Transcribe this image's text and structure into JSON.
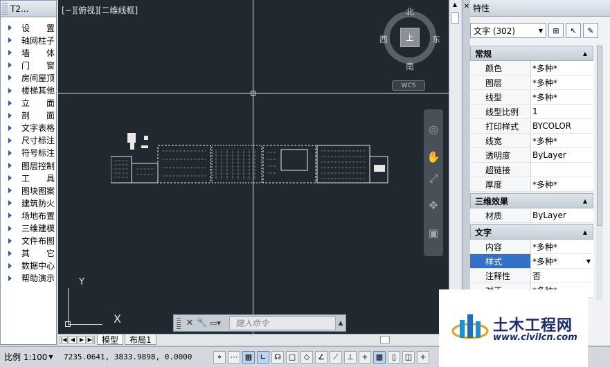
{
  "left_panel": {
    "title": "T2...",
    "items": [
      {
        "label": "设置",
        "spread": true,
        "chars": [
          "设",
          "置"
        ]
      },
      {
        "label": "轴网柱子"
      },
      {
        "label": "墙体",
        "spread": true,
        "chars": [
          "墙",
          "体"
        ]
      },
      {
        "label": "门窗",
        "spread": true,
        "chars": [
          "门",
          "窗"
        ]
      },
      {
        "label": "房间屋顶"
      },
      {
        "label": "楼梯其他"
      },
      {
        "label": "立面",
        "spread": true,
        "chars": [
          "立",
          "面"
        ]
      },
      {
        "label": "剖面",
        "spread": true,
        "chars": [
          "剖",
          "面"
        ]
      },
      {
        "label": "文字表格"
      },
      {
        "label": "尺寸标注"
      },
      {
        "label": "符号标注"
      },
      {
        "label": "图层控制"
      },
      {
        "label": "工具",
        "spread": true,
        "chars": [
          "工",
          "具"
        ]
      },
      {
        "label": "图块图案"
      },
      {
        "label": "建筑防火"
      },
      {
        "label": "场地布置"
      },
      {
        "label": "三维建模"
      },
      {
        "label": "文件布图"
      },
      {
        "label": "其它",
        "spread": true,
        "chars": [
          "其",
          "它"
        ]
      },
      {
        "label": "数据中心"
      },
      {
        "label": "帮助演示"
      }
    ]
  },
  "canvas": {
    "viewport_label": "[−][俯视][二维线框]",
    "viewcube": {
      "north": "北",
      "south": "南",
      "west": "西",
      "east": "东",
      "face": "上"
    },
    "wcs_label": "WCS",
    "ucs": {
      "y": "Y",
      "x": "X"
    }
  },
  "command": {
    "placeholder": "键入命令"
  },
  "tabs": {
    "model": "模型",
    "layout1": "布局1"
  },
  "properties": {
    "title": "特性",
    "selection": "文字 (302)",
    "sections": [
      {
        "name": "常规",
        "rows": [
          {
            "k": "颜色",
            "v": "*多种*"
          },
          {
            "k": "图层",
            "v": "*多种*"
          },
          {
            "k": "线型",
            "v": "*多种*"
          },
          {
            "k": "线型比例",
            "v": "1"
          },
          {
            "k": "打印样式",
            "v": "BYCOLOR"
          },
          {
            "k": "线宽",
            "v": "*多种*"
          },
          {
            "k": "透明度",
            "v": "ByLayer"
          },
          {
            "k": "超链接",
            "v": ""
          },
          {
            "k": "厚度",
            "v": "*多种*"
          }
        ]
      },
      {
        "name": "三维效果",
        "rows": [
          {
            "k": "材质",
            "v": "ByLayer"
          }
        ]
      },
      {
        "name": "文字",
        "rows": [
          {
            "k": "内容",
            "v": "*多种*"
          },
          {
            "k": "样式",
            "v": "*多种*",
            "selected": true
          },
          {
            "k": "注释性",
            "v": "否"
          },
          {
            "k": "对正",
            "v": "*多种*"
          }
        ]
      }
    ]
  },
  "status": {
    "scale": "比例 1:100",
    "coords": "7235.0641,  3833.9898, 0.0000"
  },
  "watermark": {
    "name": "土木工程网",
    "url": "www.civilcn.com"
  }
}
